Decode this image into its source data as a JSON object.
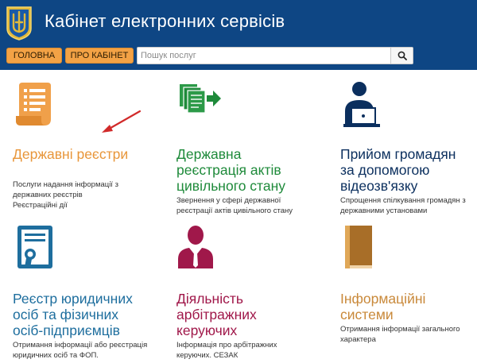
{
  "header": {
    "title": "Кабінет електронних сервісів",
    "nav": [
      {
        "label": "ГОЛОВНА"
      },
      {
        "label": "ПРО КАБІНЕТ"
      }
    ],
    "search": {
      "placeholder": "Пошук послуг",
      "value": ""
    }
  },
  "tiles": [
    {
      "title": "Державні реєстри",
      "desc_lines": [
        "Послуги надання інформації з",
        "державних реєстрів",
        "Реєстраційні дії"
      ],
      "color": "#e8963a",
      "icon": "document-scroll-icon"
    },
    {
      "title_lines": [
        "Державна",
        "реєстрація актів",
        "цивільного стану"
      ],
      "desc_lines": [
        "Звернення у сфері державної",
        "реєстрації актів цивільного стану"
      ],
      "color": "#1e8a3a",
      "icon": "documents-arrow-icon"
    },
    {
      "title_lines": [
        "Прийом громадян",
        "за допомогою",
        "відеозв'язку"
      ],
      "desc_lines": [
        "Спрощення спілкування громадян з",
        "державними установами"
      ],
      "color": "#0b2f5e",
      "icon": "person-laptop-icon"
    },
    {
      "title_lines": [
        "Реєстр юридичних",
        "осіб та фізичних",
        "осіб-підприємців"
      ],
      "desc_lines": [
        "Отримання інформації або реєстрація",
        "юридичних осіб та ФОП."
      ],
      "color": "#1e6e9e",
      "icon": "certificate-icon"
    },
    {
      "title_lines": [
        "Діяльність",
        "арбітражних",
        "керуючих"
      ],
      "desc_lines": [
        "Інформація про арбітражних",
        "керуючих. СЕЗАК"
      ],
      "color": "#a0184a",
      "icon": "businessman-icon"
    },
    {
      "title_lines": [
        "Інформаційні",
        "системи"
      ],
      "desc_lines": [
        "Отримання інформації загального",
        "характера"
      ],
      "color": "#c9893a",
      "icon": "book-icon"
    }
  ],
  "colors": {
    "header_bg": "#0e4684",
    "nav_btn": "#f3a245",
    "arrow": "#d12a2a"
  }
}
